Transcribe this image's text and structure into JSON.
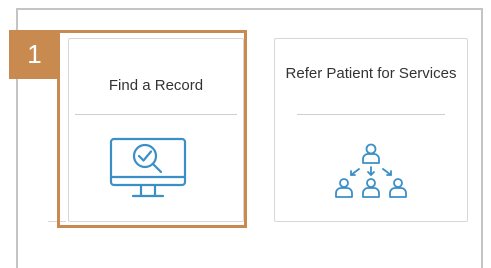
{
  "step": {
    "number": "1"
  },
  "cards": [
    {
      "title": "Find a Record",
      "icon": "monitor-search-icon"
    },
    {
      "title": "Refer Patient for Services",
      "icon": "referral-hierarchy-icon"
    }
  ],
  "colors": {
    "accent": "#c98a4f",
    "icon": "#3a8fc7",
    "border": "#c4c4c4",
    "text": "#333333"
  }
}
